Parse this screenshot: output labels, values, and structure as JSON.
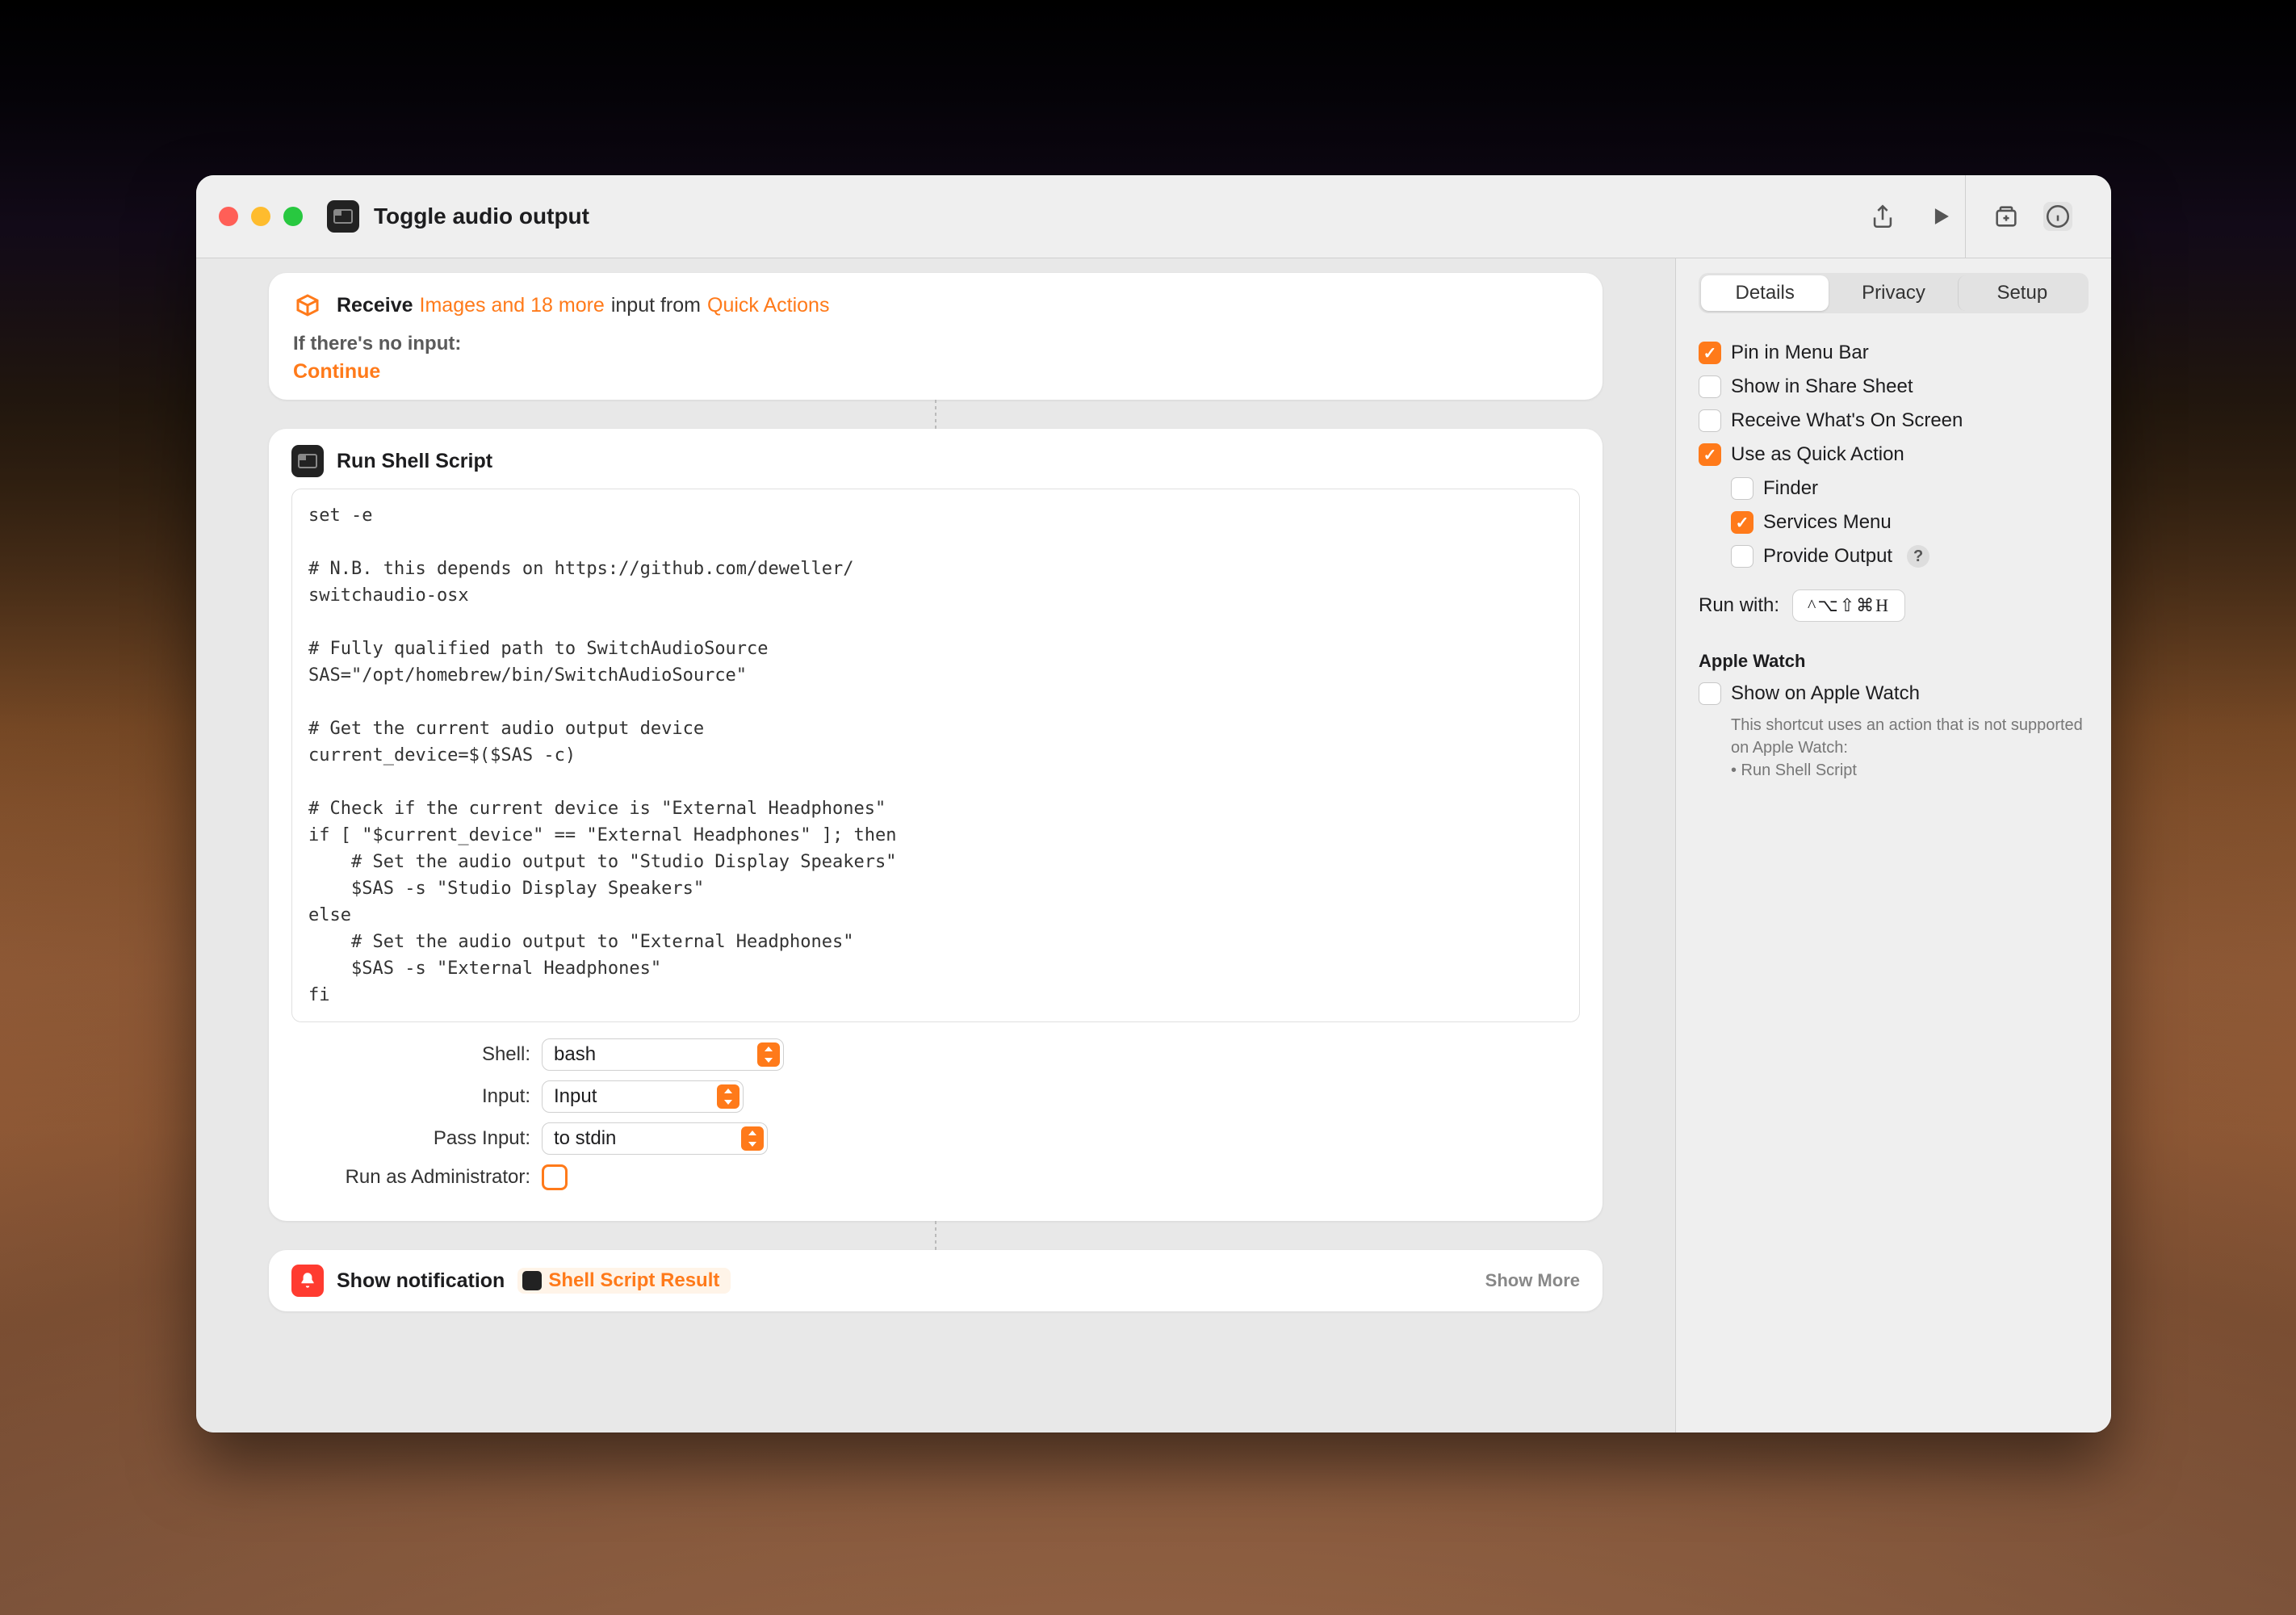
{
  "window": {
    "title": "Toggle audio output"
  },
  "receive": {
    "label": "Receive",
    "types": "Images and 18 more",
    "from_label": "input from",
    "source": "Quick Actions",
    "no_input_label": "If there's no input:",
    "no_input_action": "Continue"
  },
  "shell": {
    "title": "Run Shell Script",
    "code": "set -e\n\n# N.B. this depends on https://github.com/deweller/\nswitchaudio-osx\n\n# Fully qualified path to SwitchAudioSource\nSAS=\"/opt/homebrew/bin/SwitchAudioSource\"\n\n# Get the current audio output device\ncurrent_device=$($SAS -c)\n\n# Check if the current device is \"External Headphones\"\nif [ \"$current_device\" == \"External Headphones\" ]; then\n    # Set the audio output to \"Studio Display Speakers\"\n    $SAS -s \"Studio Display Speakers\"\nelse\n    # Set the audio output to \"External Headphones\"\n    $SAS -s \"External Headphones\"\nfi",
    "form": {
      "shell_label": "Shell:",
      "shell_value": "bash",
      "input_label": "Input:",
      "input_value": "Input",
      "pass_label": "Pass Input:",
      "pass_value": "to stdin",
      "admin_label": "Run as Administrator:"
    }
  },
  "notify": {
    "title": "Show notification",
    "variable": "Shell Script Result",
    "show_more": "Show More"
  },
  "sidebar": {
    "tabs": {
      "details": "Details",
      "privacy": "Privacy",
      "setup": "Setup"
    },
    "pin_menu": "Pin in Menu Bar",
    "share_sheet": "Show in Share Sheet",
    "on_screen": "Receive What's On Screen",
    "quick_action": "Use as Quick Action",
    "finder": "Finder",
    "services": "Services Menu",
    "provide_output": "Provide Output",
    "run_with_label": "Run with:",
    "shortcut": "^⌥⇧⌘H",
    "watch_header": "Apple Watch",
    "watch_opt": "Show on Apple Watch",
    "watch_note1": "This shortcut uses an action that is not supported on Apple Watch:",
    "watch_note2": "• Run Shell Script"
  }
}
